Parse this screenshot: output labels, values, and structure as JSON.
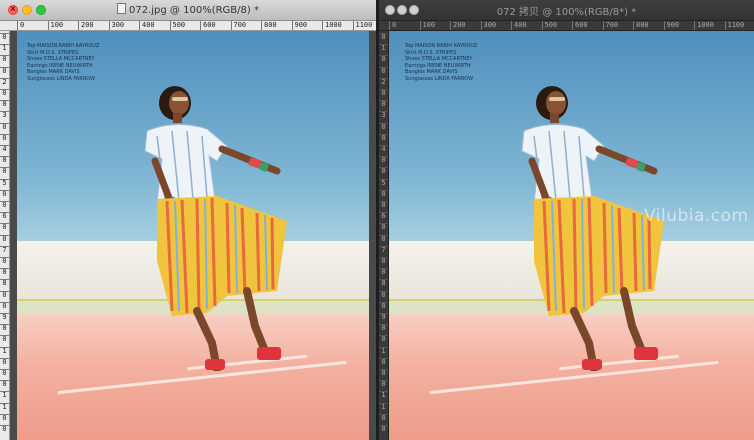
{
  "windows": [
    {
      "id": "left",
      "title": "072.jpg @ 100%(RGB/8) *",
      "ruler_h": [
        "0",
        "100",
        "200",
        "300",
        "400",
        "500",
        "600",
        "700",
        "800",
        "900",
        "1000",
        "1100"
      ],
      "ruler_v": [
        "0",
        "1",
        "0",
        "0",
        "2",
        "0",
        "0",
        "3",
        "0",
        "0",
        "4",
        "0",
        "0",
        "5",
        "0",
        "0",
        "6",
        "0",
        "0",
        "7",
        "0",
        "0",
        "8",
        "0",
        "0",
        "9",
        "0",
        "0",
        "1",
        "0",
        "0",
        "0",
        "1",
        "1",
        "0",
        "0"
      ]
    },
    {
      "id": "right",
      "title": "072 拷贝 @ 100%(RGB/8*) *",
      "ruler_h": [
        "0",
        "100",
        "200",
        "300",
        "400",
        "500",
        "600",
        "700",
        "800",
        "900",
        "1000",
        "1100"
      ],
      "ruler_v": [
        "0",
        "1",
        "0",
        "0",
        "2",
        "0",
        "0",
        "3",
        "0",
        "0",
        "4",
        "0",
        "0",
        "5",
        "0",
        "0",
        "6",
        "0",
        "0",
        "7",
        "0",
        "0",
        "8",
        "0",
        "0",
        "9",
        "0",
        "0",
        "1",
        "0",
        "0",
        "0",
        "1",
        "1",
        "0",
        "0"
      ]
    }
  ],
  "credits": [
    "Top MAISON RABIH KAYROUZ",
    "Skirt M.D.S. STRIPES",
    "Shoes STELLA MCCARTNEY",
    "Earrings IRENE NEUWIRTH",
    "Bangles MARK DAVIS",
    "Sunglasses LINDA FARROW"
  ],
  "watermark": "Vilubia.com",
  "colors": {
    "sky": "#5b99c3",
    "ground": "#f2ab9b",
    "skirt_yellow": "#f1c43d",
    "shoe_red": "#e0343c"
  }
}
